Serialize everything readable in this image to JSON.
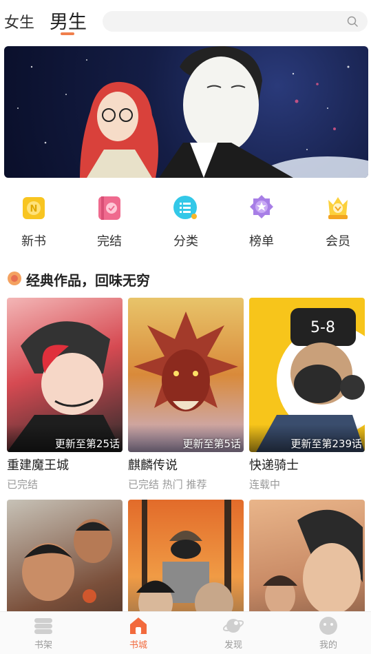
{
  "header": {
    "tabs": [
      {
        "label": "女生",
        "active": false
      },
      {
        "label": "男生",
        "active": true
      }
    ],
    "search": {
      "placeholder": "",
      "icon": "search-icon"
    },
    "accent_color": "#f07f4c"
  },
  "categories": [
    {
      "label": "新书",
      "icon": "new-book-icon"
    },
    {
      "label": "完结",
      "icon": "completed-icon"
    },
    {
      "label": "分类",
      "icon": "category-list-icon"
    },
    {
      "label": "榜单",
      "icon": "ranking-badge-icon"
    },
    {
      "label": "会员",
      "icon": "vip-crown-icon"
    }
  ],
  "section": {
    "title": "经典作品，回味无穷",
    "icon": "section-bullet-icon"
  },
  "comics": [
    {
      "title": "重建魔王城",
      "status": "已完结",
      "badge": "更新至第25话"
    },
    {
      "title": "麒麟传说",
      "status": "已完结 热门 推荐",
      "badge": "更新至第5话"
    },
    {
      "title": "快递骑士",
      "status": "连载中",
      "badge": "更新至第239话"
    },
    {
      "title": "",
      "status": "",
      "badge": ""
    },
    {
      "title": "",
      "status": "",
      "badge": ""
    },
    {
      "title": "",
      "status": "",
      "badge": ""
    }
  ],
  "bottom_nav": [
    {
      "label": "书架",
      "icon": "bookshelf-icon",
      "active": false
    },
    {
      "label": "书城",
      "icon": "home-icon",
      "active": true
    },
    {
      "label": "发现",
      "icon": "discover-planet-icon",
      "active": false
    },
    {
      "label": "我的",
      "icon": "profile-face-icon",
      "active": false
    }
  ]
}
